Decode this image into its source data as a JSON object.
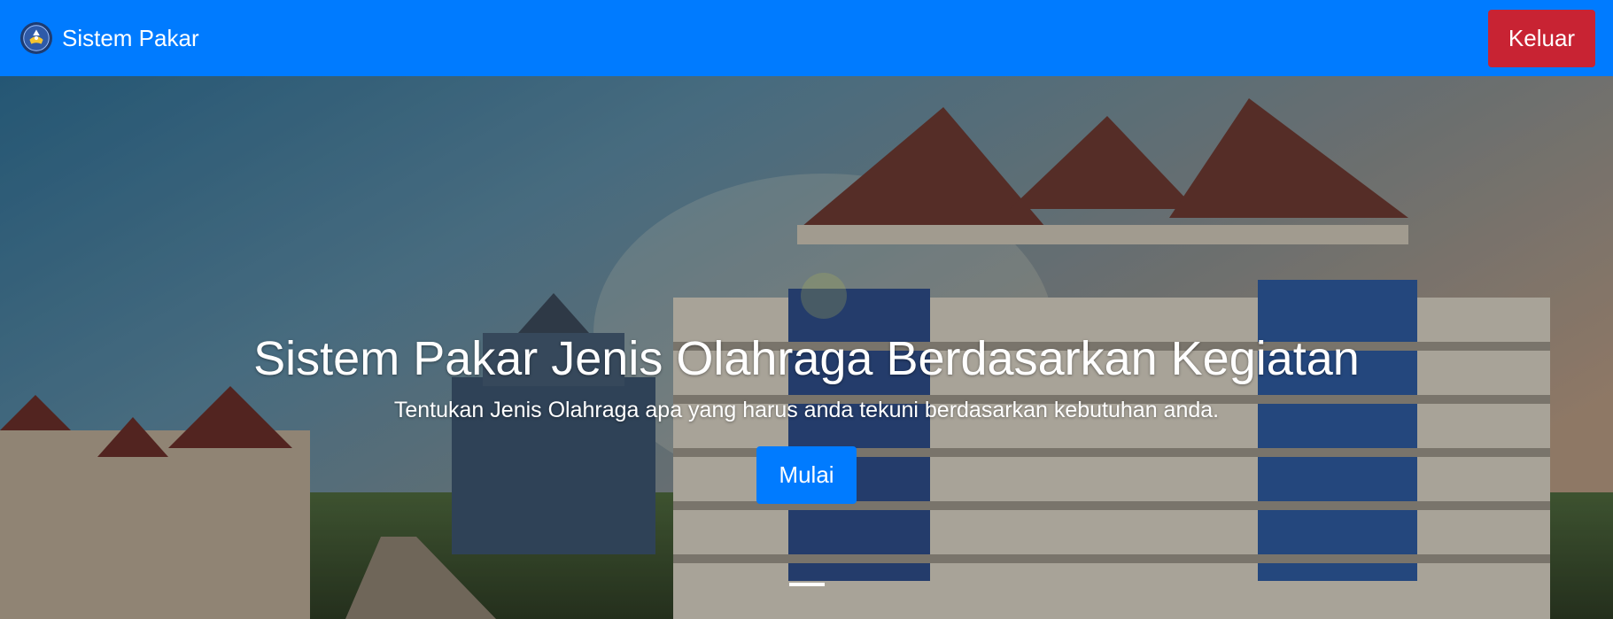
{
  "navbar": {
    "brand_label": "Sistem Pakar",
    "logo_icon": "university-logo-icon",
    "logout_label": "Keluar",
    "colors": {
      "primary": "#007bff",
      "danger": "#c82333"
    }
  },
  "hero": {
    "title": "Sistem Pakar Jenis Olahraga Berdasarkan Kegiatan",
    "subtitle": "Tentukan Jenis Olahraga apa yang harus anda tekuni berdasarkan kebutuhan anda.",
    "start_label": "Mulai",
    "slide_indicators": [
      {
        "active": true
      }
    ]
  }
}
